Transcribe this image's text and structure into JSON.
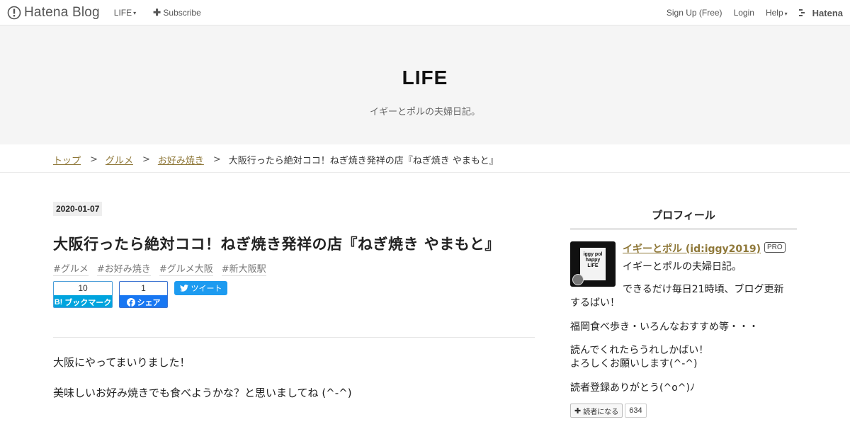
{
  "globalbar": {
    "logo_text": "Hatena Blog",
    "menu": [
      {
        "label": "LIFE",
        "caret": "▾"
      },
      {
        "label": "Subscribe",
        "icon": "plus-icon"
      }
    ],
    "right": [
      {
        "label": "Sign Up (Free)"
      },
      {
        "label": "Login"
      },
      {
        "label": "Help",
        "caret": "▾"
      }
    ],
    "hatena_label": "Hatena"
  },
  "header": {
    "title": "LIFE",
    "description": "イギーとポルの夫婦日記。"
  },
  "breadcrumb": {
    "items": [
      "トップ",
      "グルメ",
      "お好み焼き"
    ],
    "current": "大阪行ったら絶対ココ！ねぎ焼き発祥の店『ねぎ焼き やまもと』",
    "separator": ">"
  },
  "entry": {
    "date": "2020-01-07",
    "title": "大阪行ったら絶対ココ！ねぎ焼き発祥の店『ねぎ焼き やまもと』",
    "tags": [
      "#グルメ",
      "#お好み焼き",
      "#グルメ大阪",
      "#新大阪駅"
    ],
    "share": {
      "bookmark_count": "10",
      "bookmark_label": "ブックマーク",
      "bookmark_prefix": "B!",
      "facebook_count": "1",
      "facebook_label": "シェア",
      "tweet_label": "ツイート"
    },
    "paragraphs": [
      "大阪にやってまいりました！",
      "美味しいお好み焼きでも食べようかな？と思いましてね (^-^)"
    ]
  },
  "sidebar": {
    "title": "プロフィール",
    "avatar_text": [
      "iggy pol",
      "happy",
      "LIFE"
    ],
    "name": "イギーとポル (id:iggy2019)",
    "badge": "PRO",
    "lines": [
      "イギーとポルの夫婦日記。",
      "できるだけ毎日21時頃、ブログ更新",
      "するばい！",
      "福岡食べ歩き・いろんなおすすめ等・・・",
      "読んでくれたらうれしかばい！",
      "よろしくお願いします(^-^)",
      "読者登録ありがとう(^o^)ﾉ"
    ],
    "subscribe_label": "読者になる",
    "subscriber_count": "634"
  },
  "colors": {
    "link": "#8f7839",
    "header_bg": "#f5f5f5",
    "bookmark_blue": "#00a4de",
    "facebook_blue": "#1877f2",
    "twitter_blue": "#1d9bf0"
  }
}
